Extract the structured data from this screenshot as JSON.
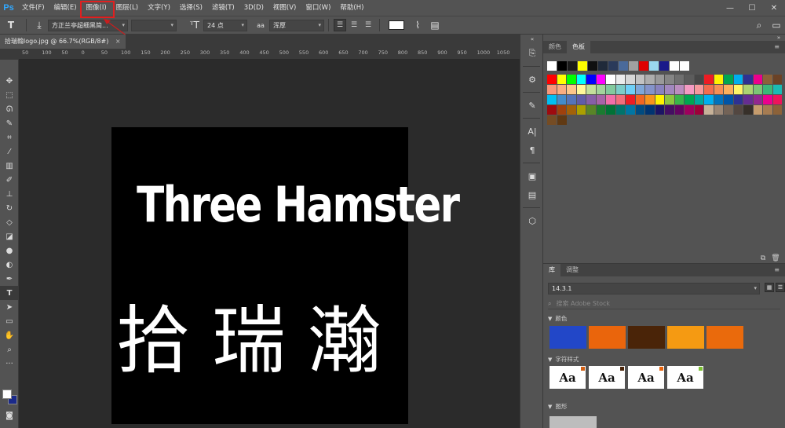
{
  "app": {
    "logo": "Ps"
  },
  "menu": [
    {
      "id": "file",
      "label": "文件(F)"
    },
    {
      "id": "edit",
      "label": "编辑(E)"
    },
    {
      "id": "image",
      "label": "图像(I)"
    },
    {
      "id": "layer",
      "label": "图层(L)"
    },
    {
      "id": "type",
      "label": "文字(Y)"
    },
    {
      "id": "select",
      "label": "选择(S)"
    },
    {
      "id": "filter",
      "label": "滤镜(T)"
    },
    {
      "id": "3d",
      "label": "3D(D)"
    },
    {
      "id": "view",
      "label": "视图(V)"
    },
    {
      "id": "window",
      "label": "窗口(W)"
    },
    {
      "id": "help",
      "label": "帮助(H)"
    }
  ],
  "window_controls": {
    "minimize": "—",
    "maximize": "☐",
    "close": "✕"
  },
  "options_bar": {
    "tool_glyph": "T",
    "font_family": "方正兰亭超细黑简...",
    "font_style": "",
    "font_size": "24 点",
    "antialias": "浑厚",
    "text_color": "#ffffff"
  },
  "document_tab": {
    "title": "拾瑞翰logo.jpg @ 66.7%(RGB/8#)",
    "close": "×"
  },
  "ruler": {
    "ticks": [
      "50",
      "100",
      "50",
      "0",
      "50",
      "100",
      "150",
      "200",
      "250",
      "300",
      "350",
      "400",
      "450",
      "500",
      "550",
      "600",
      "650",
      "700",
      "750",
      "800",
      "850",
      "900",
      "950",
      "1000",
      "1050"
    ]
  },
  "document": {
    "background": "#000000",
    "logo_text_en": "Three Hamster",
    "logo_text_cn": "拾瑞瀚"
  },
  "swatches_panel": {
    "tabs": [
      {
        "label": "颜色",
        "active": false
      },
      {
        "label": "色板",
        "active": true
      }
    ],
    "rows": [
      [
        "#ffffff",
        "#000000",
        "#1a1a1a",
        "#ffff00",
        "#101010",
        "#202a3a",
        "#2a3a5a",
        "#4a6a9a",
        "#a0a0a0",
        "#e00000",
        "#9ad8f0",
        "#1a1a8a",
        "#ffffff",
        "#ffffff"
      ],
      [
        "#ff0000",
        "#ffff00",
        "#00ff00",
        "#00ffff",
        "#0000ff",
        "#ff00ff",
        "#ffffff",
        "#ebebeb",
        "#d6d6d6",
        "#c2c2c2",
        "#adadad",
        "#999999",
        "#858585",
        "#707070",
        "#5c5c5c",
        "#474747",
        "#ed1c24",
        "#fff200",
        "#00a651",
        "#00aeef",
        "#2e3192",
        "#ec008c",
        "#8c6239",
        "#6b4226"
      ],
      [
        "#f7977a",
        "#f9ad81",
        "#fdc68a",
        "#fff79a",
        "#c4df9b",
        "#a3d39c",
        "#82ca9d",
        "#7bcdc8",
        "#6ecff6",
        "#7ea7d8",
        "#8493ca",
        "#8882be",
        "#a187be",
        "#bc8dbf",
        "#f49ac2",
        "#f6989d",
        "#f26c4f",
        "#f68e55",
        "#fbaf5c",
        "#fff467",
        "#acd372",
        "#7cc576",
        "#3bb878",
        "#1abbb4"
      ],
      [
        "#00bff3",
        "#438ccb",
        "#5574b9",
        "#605ca8",
        "#855fa8",
        "#a763a8",
        "#f06ea9",
        "#f26d7d",
        "#ed1c24",
        "#f26522",
        "#f7941d",
        "#fff200",
        "#8dc63f",
        "#39b54a",
        "#00a651",
        "#00a99d",
        "#00aeef",
        "#0072bc",
        "#0054a6",
        "#2e3192",
        "#662d91",
        "#92278f",
        "#ec008c",
        "#ed145b"
      ],
      [
        "#9e0b0f",
        "#a0410d",
        "#a36209",
        "#aba000",
        "#598527",
        "#1a7b30",
        "#007236",
        "#00746b",
        "#0076a3",
        "#004b80",
        "#003471",
        "#1b1464",
        "#440e62",
        "#630460",
        "#9e005d",
        "#9e0039",
        "#c7b299",
        "#998675",
        "#736357",
        "#534741",
        "#37302a",
        "#c69c6d",
        "#a67c52",
        "#8c6239"
      ],
      [
        "#754c24",
        "#603913"
      ]
    ],
    "footer_icons": [
      "new-swatch-icon",
      "trash-icon"
    ]
  },
  "library_panel": {
    "tabs": [
      {
        "label": "库",
        "active": true
      },
      {
        "label": "调整",
        "active": false
      }
    ],
    "library_name": "14.3.1",
    "search_placeholder": "搜索 Adobe Stock",
    "colors_title": "颜色",
    "colors": [
      "#2247c8",
      "#ea650c",
      "#4a2408",
      "#f59a12",
      "#ea6a0c"
    ],
    "char_styles_title": "字符样式",
    "char_styles": [
      {
        "sample": "Aa",
        "accent": "#d26014"
      },
      {
        "sample": "Aa",
        "accent": "#4a2408"
      },
      {
        "sample": "Aa",
        "accent": "#ea650c"
      },
      {
        "sample": "Aa",
        "accent": "#7cc034"
      }
    ],
    "graphics_title": "图形"
  }
}
